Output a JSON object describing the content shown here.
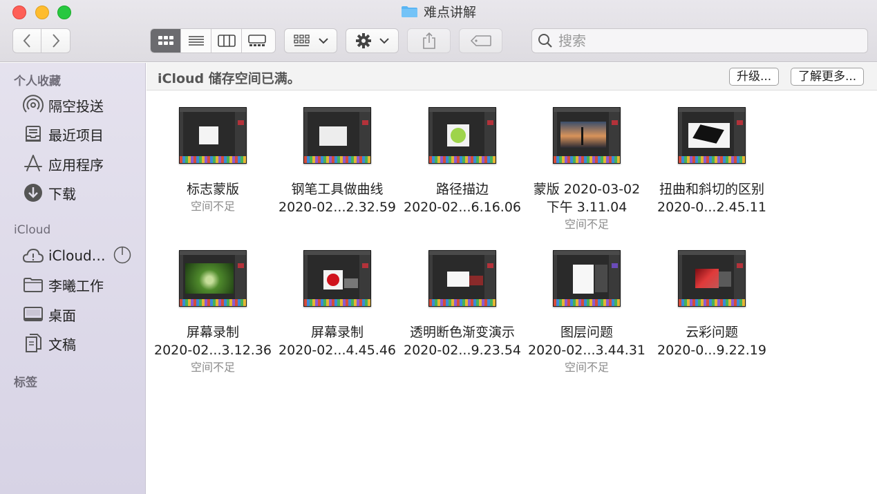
{
  "window": {
    "title": "难点讲解",
    "accent": "#1f8ef1"
  },
  "toolbar": {
    "back_icon": "chevron-left-icon",
    "forward_icon": "chevron-right-icon",
    "view_modes": [
      "icon-view",
      "list-view",
      "column-view",
      "gallery-view"
    ],
    "active_view": "icon-view",
    "group_icon": "group-by-icon",
    "action_icon": "gear-icon",
    "share_icon": "share-icon",
    "tag_icon": "tag-icon",
    "search_placeholder": "搜索"
  },
  "sidebar": {
    "favorites_header": "个人收藏",
    "favorites": [
      {
        "label": "隔空投送",
        "icon": "airdrop-icon"
      },
      {
        "label": "最近项目",
        "icon": "recents-icon"
      },
      {
        "label": "应用程序",
        "icon": "applications-icon"
      },
      {
        "label": "下载",
        "icon": "downloads-icon"
      }
    ],
    "icloud_header": "iCloud",
    "icloud": [
      {
        "label": "iCloud…",
        "icon": "icloud-icon"
      },
      {
        "label": "李曦工作",
        "icon": "folder-icon"
      },
      {
        "label": "桌面",
        "icon": "desktop-icon"
      },
      {
        "label": "文稿",
        "icon": "documents-icon"
      }
    ],
    "tags_header": "标签"
  },
  "banner": {
    "text": "iCloud 储存空间已满。",
    "upgrade_label": "升级...",
    "learn_more_label": "了解更多..."
  },
  "files": [
    {
      "name": "标志蒙版",
      "line2": "",
      "note": "空间不足"
    },
    {
      "name": "钢笔工具做曲线",
      "line2": "2020-02...2.32.59",
      "note": ""
    },
    {
      "name": "路径描边",
      "line2": "2020-02...6.16.06",
      "note": ""
    },
    {
      "name": "蒙版 2020-03-02",
      "line2": "下午 3.11.04",
      "note": "空间不足"
    },
    {
      "name": "扭曲和斜切的区别",
      "line2": "2020-0...2.45.11",
      "note": ""
    },
    {
      "name": "屏幕录制",
      "line2": "2020-02...3.12.36",
      "note": "空间不足"
    },
    {
      "name": "屏幕录制",
      "line2": "2020-02...4.45.46",
      "note": ""
    },
    {
      "name": "透明断色渐变演示",
      "line2": "2020-02...9.23.54",
      "note": ""
    },
    {
      "name": "图层问题",
      "line2": "2020-02...3.44.31",
      "note": "空间不足"
    },
    {
      "name": "云彩问题",
      "line2": "2020-0...9.22.19",
      "note": ""
    }
  ]
}
